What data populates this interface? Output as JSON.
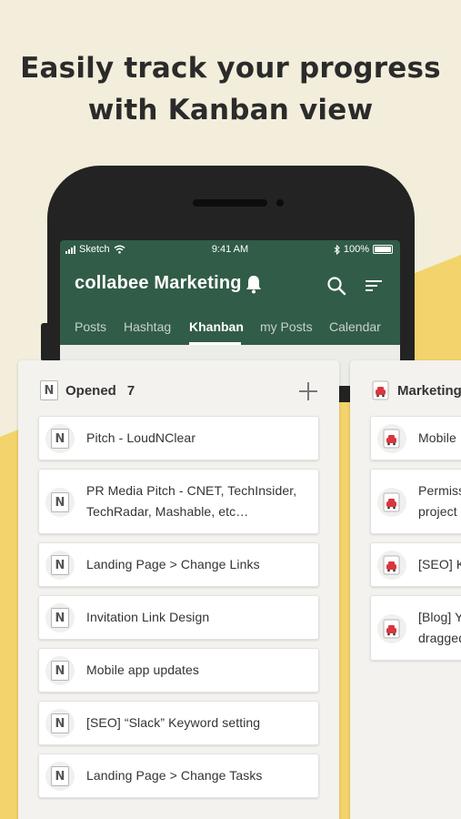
{
  "headline": {
    "line1": "Easily track your progress",
    "line2": "with Kanban view"
  },
  "status_bar": {
    "carrier": "Sketch",
    "time": "9:41 AM",
    "battery": "100%"
  },
  "app": {
    "title": "collabee Marketing",
    "tabs": [
      "Posts",
      "Hashtag",
      "Khanban",
      "my Posts",
      "Calendar"
    ],
    "active_tab": "Khanban"
  },
  "columns": [
    {
      "title": "Opened",
      "count": "7",
      "icon": "n-document-icon",
      "cards": [
        {
          "lines": [
            "Pitch - LoudNClear"
          ]
        },
        {
          "lines": [
            "PR Media Pitch - CNET, TechInsider,",
            "TechRadar, Mashable, etc…"
          ]
        },
        {
          "lines": [
            "Landing Page > Change Links"
          ]
        },
        {
          "lines": [
            "Invitation Link Design"
          ]
        },
        {
          "lines": [
            "Mobile app updates"
          ]
        },
        {
          "lines": [
            "[SEO] “Slack” Keyword setting"
          ]
        },
        {
          "lines": [
            "Landing Page > Change Tasks"
          ]
        }
      ]
    },
    {
      "title": "Marketing",
      "icon": "red-document-icon",
      "cards": [
        {
          "lines": [
            "Mobile"
          ]
        },
        {
          "lines": [
            "Permiss",
            "project"
          ]
        },
        {
          "lines": [
            "[SEO] K"
          ]
        },
        {
          "lines": [
            "[Blog] Y",
            "dragged"
          ]
        }
      ]
    }
  ],
  "colors": {
    "background": "#f2eedb",
    "accent_yellow": "#f3d36c",
    "app_green": "#315c48",
    "phone_frame": "#232323"
  }
}
